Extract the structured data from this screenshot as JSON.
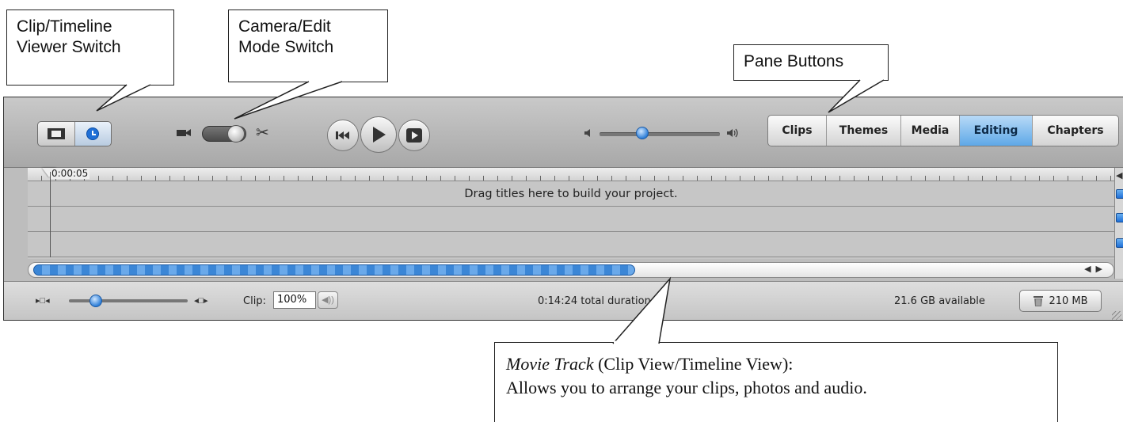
{
  "callouts": {
    "viewer_switch": "Clip/Timeline\nViewer Switch",
    "mode_switch": "Camera/Edit\nMode Switch",
    "pane_buttons": "Pane Buttons",
    "movie_track_title": "Movie Track",
    "movie_track_rest": " (Clip View/Timeline View):",
    "movie_track_line2": "Allows you to arrange your clips, photos and audio."
  },
  "toolbar": {
    "view_switch": {
      "clip_icon": "filmstrip-icon",
      "timeline_icon": "clock-icon",
      "selected": "timeline"
    },
    "mode": {
      "camera_icon": "camera-icon",
      "edit_icon": "scissors-icon",
      "selected": "edit"
    },
    "transport": [
      "rewind-icon",
      "play-icon",
      "fullscreen-play-icon"
    ],
    "volume_level": 0.3,
    "panes": [
      {
        "label": "Clips",
        "active": false
      },
      {
        "label": "Themes",
        "active": false
      },
      {
        "label": "Media",
        "active": false
      },
      {
        "label": "Editing",
        "active": true
      },
      {
        "label": "Chapters",
        "active": false
      }
    ]
  },
  "timeline": {
    "timecode": "0:00:05",
    "title_track_hint": "Drag titles here to build your project."
  },
  "status": {
    "clip_label": "Clip:",
    "clip_volume": "100%",
    "total_duration": "0:14:24 total duration",
    "available": "21.6 GB available",
    "trash_size": "210 MB"
  },
  "colors": {
    "accent": "#2e7fd8",
    "active_pane": "#5ea8e7"
  }
}
